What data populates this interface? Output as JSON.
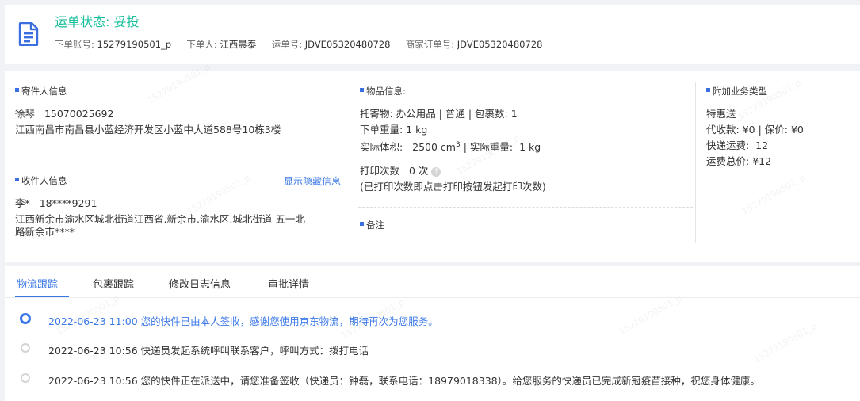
{
  "header": {
    "status_label": "运单状态:",
    "status_value": "妥投",
    "account_label": "下单账号:",
    "account_value": "15279190501_p",
    "orderer_label": "下单人:",
    "orderer_value": "江西晨泰",
    "waybill_label": "运单号:",
    "waybill_value": "JDVE05320480728",
    "merchant_order_label": "商家订单号:",
    "merchant_order_value": "JDVE05320480728",
    "icon": "document-icon"
  },
  "sender": {
    "title": "寄件人信息",
    "name": "徐琴",
    "phone": "15070025692",
    "address": "江西南昌市南昌县小蓝经济开发区小蓝中大道588号10栋3楼"
  },
  "receiver": {
    "title": "收件人信息",
    "show_hidden_link": "显示隐藏信息",
    "name": "李*",
    "phone": "18****9291",
    "address_line1": "江西新余市渝水区城北街道江西省.新余市.渝水区.城北街道 五一北",
    "address_line2": "路新余市****"
  },
  "goods": {
    "title": "物品信息:",
    "line1_label": "托寄物:",
    "line1_value": "办公用品 | 普通 | 包裹数:  1",
    "weight_label": "下单重量:",
    "weight_value": "1 kg",
    "volume_label": "实际体积:",
    "volume_value": "2500 cm",
    "volume_sup": "3",
    "actual_weight_label": "| 实际重量:",
    "actual_weight_value": "1 kg",
    "print_label": "打印次数",
    "print_value": "0 次",
    "print_help_icon": "question-circle-icon",
    "print_note": "(已打印次数即点击打印按钮发起打印次数)"
  },
  "remark": {
    "title": "备注"
  },
  "addon": {
    "title": "附加业务类型",
    "type": "特惠送",
    "cod_label": "代收款:",
    "cod_value": "¥0",
    "insured_label": "| 保价:",
    "insured_value": "¥0",
    "fee_label": "快递运费:",
    "fee_value": "12",
    "total_label": "运费总价:",
    "total_value": "¥12"
  },
  "tabs": [
    {
      "label": "物流跟踪",
      "active": true
    },
    {
      "label": "包裹跟踪",
      "active": false
    },
    {
      "label": "修改日志信息",
      "active": false
    },
    {
      "label": "审批详情",
      "active": false
    }
  ],
  "timeline": [
    {
      "time": "2022-06-23 11:00",
      "text": "您的快件已由本人签收，感谢您使用京东物流，期待再次为您服务。",
      "active": true
    },
    {
      "time": "2022-06-23 10:56",
      "text": "快递员发起系统呼叫联系客户，呼叫方式：拨打电话",
      "active": false
    },
    {
      "time": "2022-06-23 10:56",
      "text": "您的快件正在派送中，请您准备签收（快递员：钟磊，联系电话：18979018338）。给您服务的快递员已完成新冠疫苗接种，祝您身体健康。",
      "active": false
    }
  ],
  "watermark": "15279190501_p",
  "colors": {
    "status_green": "#19be9b",
    "accent_blue": "#3b78e7",
    "section_marker": "#3b6fe0"
  }
}
